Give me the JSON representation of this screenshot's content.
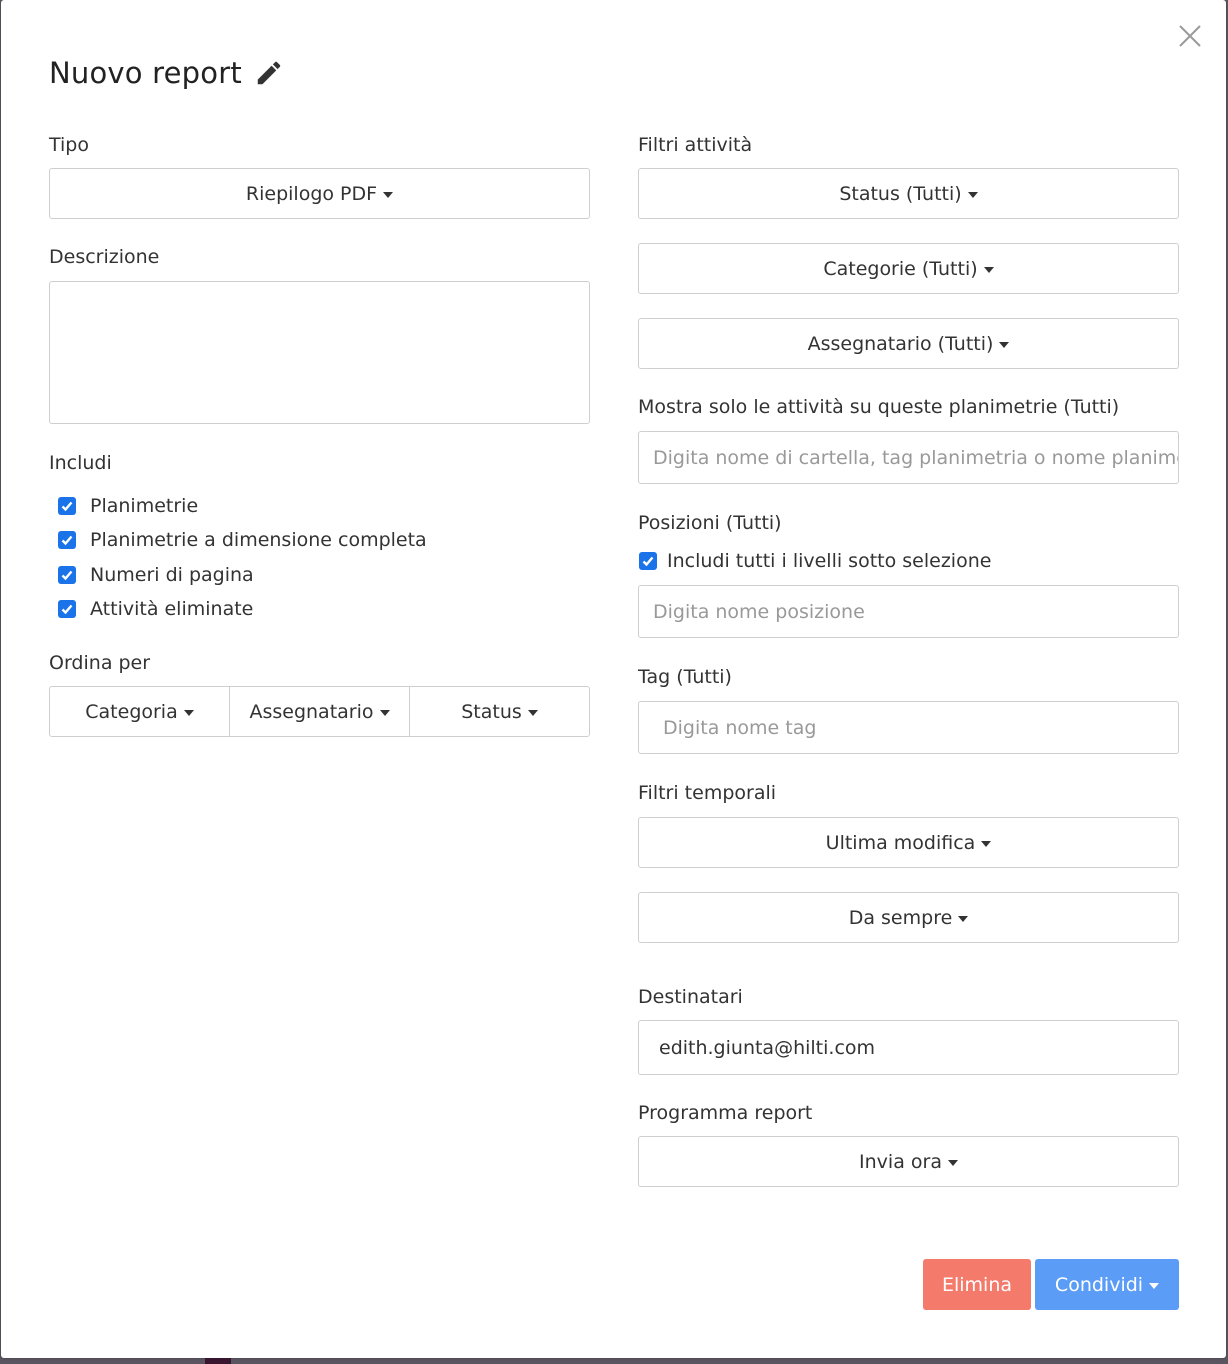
{
  "modal": {
    "title": "Nuovo report",
    "title_icon": "pencil-icon",
    "close_icon": "close-icon"
  },
  "left": {
    "type_label": "Tipo",
    "type_value": "Riepilogo PDF",
    "description_label": "Descrizione",
    "description_value": "",
    "include_label": "Includi",
    "include_options": [
      {
        "label": "Planimetrie",
        "checked": true
      },
      {
        "label": "Planimetrie a dimensione completa",
        "checked": true
      },
      {
        "label": "Numeri di pagina",
        "checked": true
      },
      {
        "label": "Attività eliminate",
        "checked": true
      }
    ],
    "sort_label": "Ordina per",
    "sort_options": [
      "Categoria",
      "Assegnatario",
      "Status"
    ]
  },
  "right": {
    "activity_filters_label": "Filtri attività",
    "status_filter": "Status (Tutti)",
    "category_filter": "Categorie (Tutti)",
    "assignee_filter": "Assegnatario (Tutti)",
    "plans_label": "Mostra solo le attività su queste planimetrie (Tutti)",
    "plans_placeholder": "Digita nome di cartella, tag planimetria o nome planimetria",
    "positions_label": "Posizioni (Tutti)",
    "positions_include_sublevels": {
      "label": "Includi tutti i livelli sotto selezione",
      "checked": true
    },
    "positions_placeholder": "Digita nome posizione",
    "tag_label": "Tag (Tutti)",
    "tag_placeholder": "Digita nome tag",
    "time_filters_label": "Filtri temporali",
    "time_field": "Ultima modifica",
    "time_range": "Da sempre",
    "recipients_label": "Destinatari",
    "recipients_value": "edith.giunta@hilti.com",
    "schedule_label": "Programma report",
    "schedule_value": "Invia ora"
  },
  "footer": {
    "delete_label": "Elimina",
    "share_label": "Condividi"
  },
  "colors": {
    "checkbox": "#1a73e8",
    "delete_button": "#f47a6b",
    "share_button": "#5b9cf7"
  }
}
